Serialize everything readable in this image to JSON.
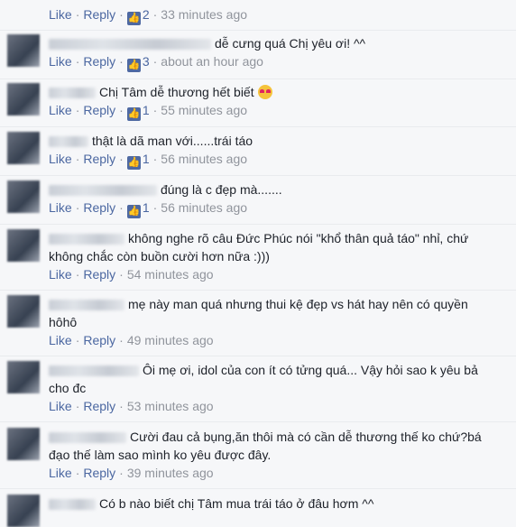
{
  "labels": {
    "like": "Like",
    "reply": "Reply",
    "sep": "·"
  },
  "top": {
    "likes": "2",
    "time": "33 minutes ago"
  },
  "comments": [
    {
      "text": "dễ cưng quá Chị yêu ơi! ^^",
      "likes": "3",
      "time": "about an hour ago"
    },
    {
      "text": "Chị Tâm dễ thương hết biết",
      "likes": "1",
      "time": "55 minutes ago"
    },
    {
      "text": "thật là dã man với......trái táo",
      "likes": "1",
      "time": "56 minutes ago"
    },
    {
      "text": "đúng là c đẹp mà.......",
      "likes": "1",
      "time": "56 minutes ago"
    },
    {
      "text1": "không nghe rõ câu Đức Phúc nói \"khổ thân quả táo\" nhỉ, chứ",
      "text2": "không chắc còn buồn cười hơn nữa :)))",
      "time": "54 minutes ago"
    },
    {
      "text1": "mẹ này man quá nhưng thui kệ đẹp vs hát hay nên có quyền",
      "text2": "hôhô",
      "time": "49 minutes ago"
    },
    {
      "text1": "Ôi mẹ ơi, idol của con ít có tửng quá... Vậy hỏi sao k yêu bả",
      "text2": "cho đc",
      "time": "53 minutes ago"
    },
    {
      "text1": "Cười đau cả bụng,ăn thôi mà có cần dễ thương thế ko chứ?bá",
      "text2": "đạo thế làm sao mình ko yêu được đây.",
      "time": "39 minutes ago"
    },
    {
      "text": "Có b nào biết chị Tâm mua trái táo ở đâu hơm ^^"
    }
  ],
  "colors": {
    "link": "#4b67a1",
    "muted": "#90949c",
    "like_badge": "#4e69a2"
  },
  "icons": [
    "thumbs-up-icon",
    "heart-eyes-emoji-icon"
  ]
}
